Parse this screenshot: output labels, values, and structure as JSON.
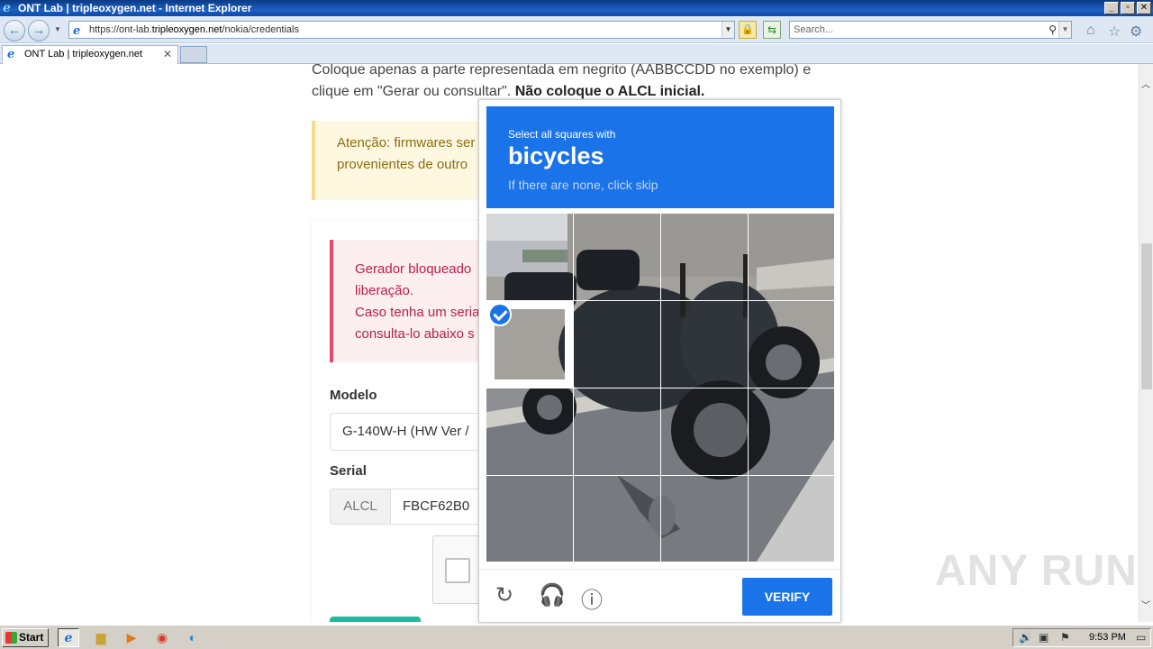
{
  "window": {
    "title": "ONT Lab | tripleoxygen.net - Internet Explorer",
    "controls": [
      "_",
      "▫",
      "✕"
    ]
  },
  "address_bar": {
    "url_prefix": "https://ont-lab.",
    "url_domain": "tripleoxygen.net",
    "url_path": "/nokia/credentials",
    "search_placeholder": "Search..."
  },
  "tab": {
    "label": "ONT Lab | tripleoxygen.net"
  },
  "page": {
    "intro_text": "Coloque apenas a parte representada em negrito (AABBCCDD no exemplo) e clique em \"Gerar ou consultar\".",
    "intro_bold": "Não coloque o ALCL inicial.",
    "warning_line1": "Atenção: firmwares ser",
    "warning_line2": "provenientes de outro",
    "danger_line1": "Gerador bloqueado",
    "danger_line2": "liberação.",
    "danger_line3": "Caso tenha um seria",
    "danger_line4": "consulta-lo abaixo s",
    "modelo_label": "Modelo",
    "modelo_value": "G-140W-H (HW Ver /",
    "serial_label": "Serial",
    "serial_prefix": "ALCL",
    "serial_value": "FBCF62B0"
  },
  "captcha": {
    "instruction": "Select all squares with",
    "target": "bicycles",
    "hint": "If there are none, click skip",
    "verify_label": "VERIFY",
    "selected_tiles": [
      4
    ],
    "accent": "#1a73e8"
  },
  "watermark": "ANY RUN",
  "taskbar": {
    "start_label": "Start",
    "clock": "9:53 PM"
  }
}
